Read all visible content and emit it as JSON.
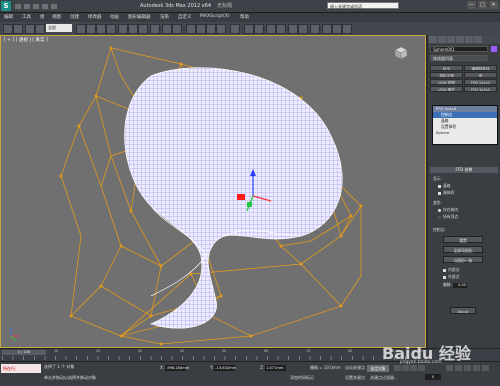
{
  "app": {
    "title": "Autodesk 3ds Max  2012 x64",
    "subtitle": "无标题",
    "search_placeholder": "键入关键字或短语",
    "window_buttons": [
      "—",
      "□",
      "✕"
    ]
  },
  "menu": [
    "编辑",
    "工具",
    "组",
    "视图",
    "创建",
    "修改器",
    "动画",
    "图形编辑器",
    "渲染",
    "自定义",
    "MAXScript(X)",
    "帮助"
  ],
  "toolbar": {
    "selection_combo": "全部"
  },
  "viewport": {
    "label": "[ + ] [ 透视 ] [ 真实 ]",
    "accent_color": "#c9a640",
    "mesh_color": "#9a8cff",
    "cage_color": "#e39a1c"
  },
  "command_panel": {
    "object_name": "Sphere001",
    "object_color": "#9a5cff",
    "modifier_list": "修改器列表",
    "modifier_buttons": [
      "挤出",
      "编辑样条线",
      "涡轮平滑",
      "壳",
      "UVW 贴图",
      "FFD 2x2x2",
      "UVW 展开",
      "FFD 3x3x3"
    ],
    "stack": {
      "top": "FFD 4x4x4",
      "items": [
        "控制点",
        "晶格",
        "设置体积"
      ],
      "base": "Sphere",
      "selected_index": 0
    },
    "rollout_title": "FFD 参数",
    "display_group": "显示:",
    "display_items": [
      "晶格",
      "源体积"
    ],
    "deform_group": "变形:",
    "deform_items": [
      "仅在体内",
      "所有顶点"
    ],
    "control_points_group": "控制点:",
    "buttons": [
      "重置",
      "全部动画化",
      "与图形一致"
    ],
    "checks": [
      "内部点",
      "外部点"
    ],
    "offset_label": "偏移:",
    "offset_value": "0.05",
    "about_button": "About"
  },
  "timeline": {
    "slider": "0 / 100",
    "tick_labels": [
      "0",
      "10",
      "20",
      "30",
      "40",
      "50",
      "60",
      "70",
      "80",
      "90",
      "100"
    ]
  },
  "status": {
    "maxscript": "所在行:",
    "line1": "选择了 1 个 对象",
    "line2": "单击并拖动以选择并移动对象",
    "x_label": "X:",
    "x_value": "-996.284mm",
    "y_label": "Y:",
    "y_value": "-13.632mm",
    "z_label": "Z:",
    "z_value": "1.071mm",
    "grid": "栅格 = 10.0mm",
    "auto_key": "自动关键点",
    "set_key": "设置关键点",
    "selected": "选定对象",
    "key_filter": "关键点过滤器...",
    "add_tag": "添加时间标记",
    "frame": "0"
  },
  "watermark": {
    "text": "Baidu 经验",
    "sub": "jingyan.baidu.com"
  }
}
